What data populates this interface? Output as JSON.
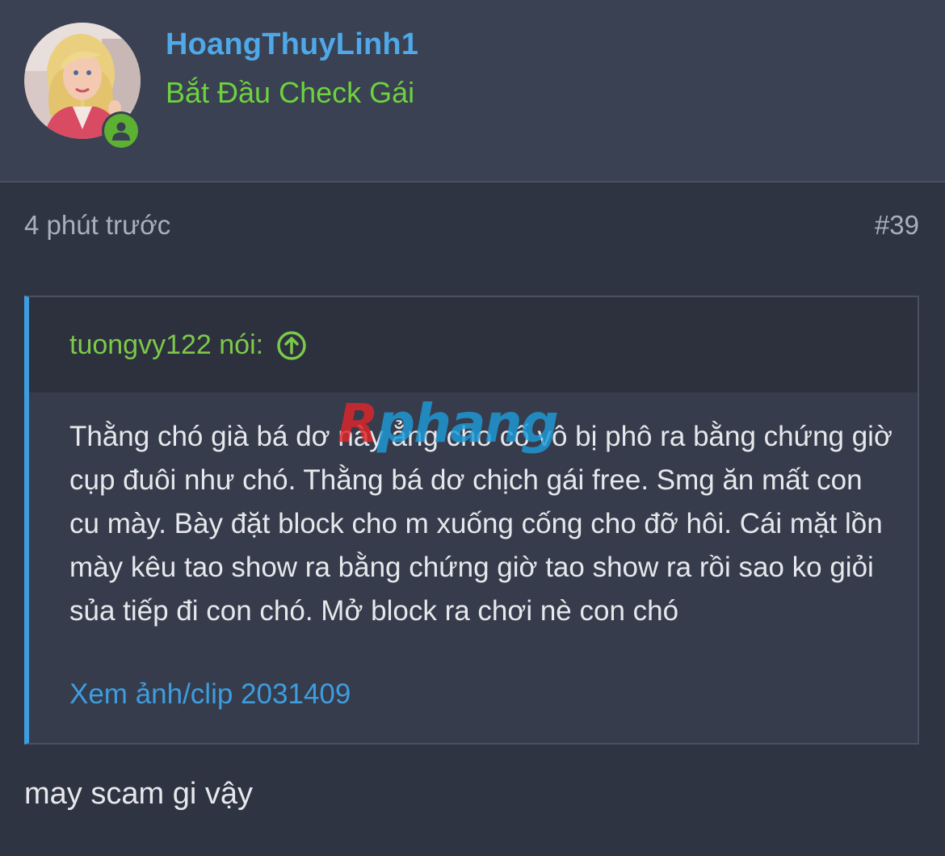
{
  "user": {
    "username": "HoangThuyLinh1",
    "title": "Bắt Đầu Check Gái",
    "status": "online"
  },
  "post": {
    "time": "4 phút trước",
    "number": "#39"
  },
  "quote": {
    "author": "tuongvy122 nói:",
    "body": "Thằng chó già bá dơ này ẳng cho cố vô bị phô ra bằng chứng giờ cụp đuôi như chó. Thằng bá dơ chịch gái free. Smg ăn mất con cu mày. Bày đặt block cho m xuống cống cho đỡ hôi. Cái mặt lồn mày kêu tao show ra bằng chứng giờ tao show ra rồi sao ko giỏi sủa tiếp đi con chó. Mở block ra chơi nè con chó",
    "link": "Xem ảnh/clip 2031409"
  },
  "watermark": {
    "first": "R",
    "rest": "phang"
  },
  "reply": {
    "text": "may scam gi vậy"
  },
  "colors": {
    "background": "#2f3442",
    "header_background": "#3a4152",
    "username": "#4fa8e8",
    "user_title": "#6ed23e",
    "quote_author": "#7cc94a",
    "link": "#3d9de0",
    "online_badge": "#5cb132"
  },
  "icons": {
    "avatar": "user-avatar",
    "online": "user-online-icon",
    "quote_jump": "arrow-up-circle-icon"
  }
}
